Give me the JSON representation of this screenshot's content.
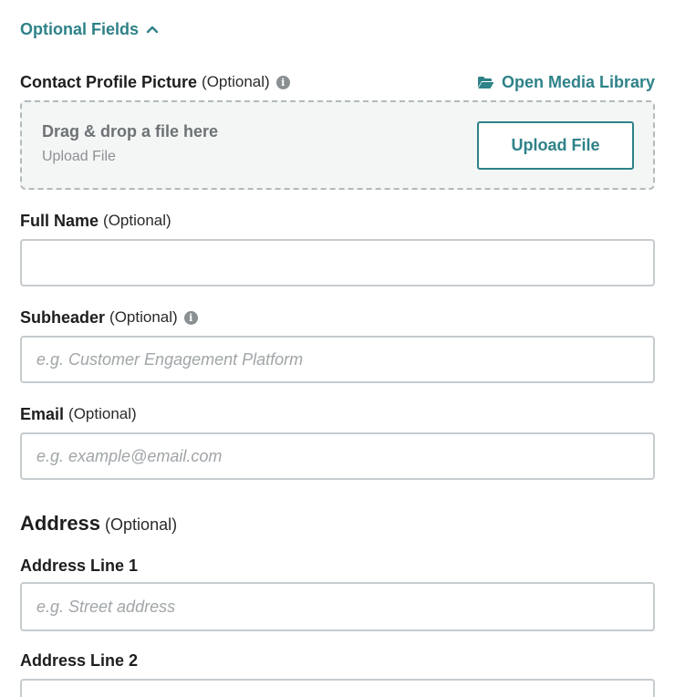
{
  "section_toggle": {
    "label": "Optional Fields",
    "icon": "chevron-up-icon",
    "expanded": true
  },
  "profile_picture": {
    "label": "Contact Profile Picture",
    "optional": "(Optional)",
    "info_icon": "i",
    "media_library_label": "Open Media Library",
    "dropzone_title": "Drag & drop a file here",
    "dropzone_subtitle": "Upload File",
    "upload_button": "Upload File"
  },
  "full_name": {
    "label": "Full Name",
    "optional": "(Optional)",
    "value": "",
    "placeholder": ""
  },
  "subheader": {
    "label": "Subheader",
    "optional": "(Optional)",
    "info_icon": "i",
    "value": "",
    "placeholder": "e.g. Customer Engagement Platform"
  },
  "email": {
    "label": "Email",
    "optional": "(Optional)",
    "value": "",
    "placeholder": "e.g. example@email.com"
  },
  "address": {
    "heading": "Address",
    "optional": "(Optional)",
    "line1": {
      "label": "Address Line 1",
      "value": "",
      "placeholder": "e.g. Street address"
    },
    "line2": {
      "label": "Address Line 2",
      "value": "",
      "placeholder": ""
    }
  },
  "colors": {
    "accent": "#2e8288",
    "border": "#c6cbce",
    "dropzone_bg": "#f4f6f6",
    "text": "#1e1e1e"
  }
}
